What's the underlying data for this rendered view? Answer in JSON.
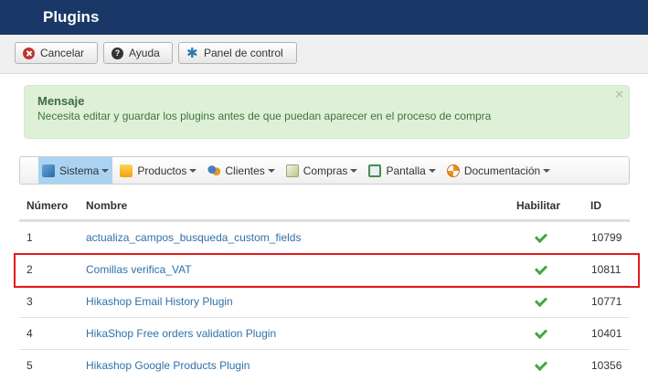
{
  "header": {
    "title": "Plugins"
  },
  "toolbar": {
    "cancel_label": "Cancelar",
    "help_label": "Ayuda",
    "panel_label": "Panel de control"
  },
  "alert": {
    "title": "Mensaje",
    "text": "Necesita editar y guardar los plugins antes de que puedan aparecer en el proceso de compra",
    "close": "×"
  },
  "menu": {
    "items": [
      {
        "label": "Sistema",
        "icon": "wrench-icon",
        "active": true
      },
      {
        "label": "Productos",
        "icon": "box-icon"
      },
      {
        "label": "Clientes",
        "icon": "users-icon"
      },
      {
        "label": "Compras",
        "icon": "clipboard-icon"
      },
      {
        "label": "Pantalla",
        "icon": "display-icon"
      },
      {
        "label": "Documentación",
        "icon": "lifebuoy-icon"
      }
    ]
  },
  "table": {
    "headers": {
      "number": "Número",
      "name": "Nombre",
      "enable": "Habilitar",
      "id": "ID"
    },
    "rows": [
      {
        "number": "1",
        "name": "actualiza_campos_busqueda_custom_fields",
        "enabled": true,
        "id": "10799"
      },
      {
        "number": "2",
        "name": "Comillas verifica_VAT",
        "enabled": true,
        "id": "10811"
      },
      {
        "number": "3",
        "name": "Hikashop Email History Plugin",
        "enabled": true,
        "id": "10771"
      },
      {
        "number": "4",
        "name": "HikaShop Free orders validation Plugin",
        "enabled": true,
        "id": "10401"
      },
      {
        "number": "5",
        "name": "Hikashop Google Products Plugin",
        "enabled": true,
        "id": "10356"
      }
    ]
  },
  "colors": {
    "header_bg": "#1a3867",
    "highlight": "#e3191e",
    "link": "#3071a9",
    "check": "#46a546"
  }
}
